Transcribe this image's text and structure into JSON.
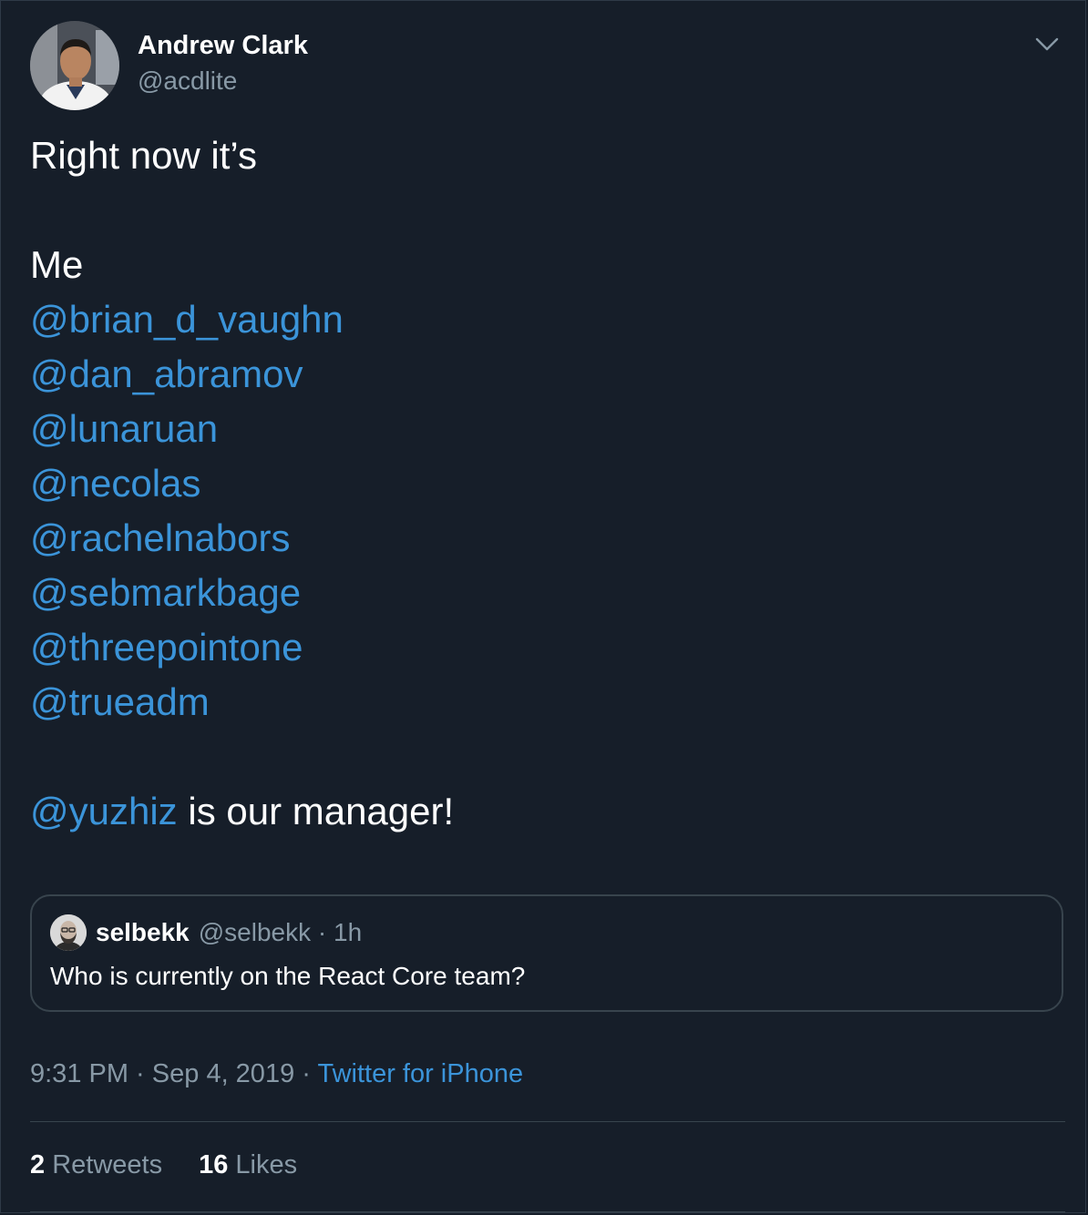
{
  "author": {
    "display_name": "Andrew Clark",
    "handle": "@acdlite"
  },
  "tweet": {
    "intro": "Right now it’s",
    "first_member": "Me",
    "members": [
      "@brian_d_vaughn",
      "@dan_abramov",
      "@lunaruan",
      "@necolas",
      "@rachelnabors",
      "@sebmarkbage",
      "@threepointone",
      "@trueadm"
    ],
    "closing_mention": "@yuzhiz",
    "closing_text": " is our manager!"
  },
  "quote": {
    "name": "selbekk",
    "handle": "@selbekk",
    "separator": " · ",
    "time": "1h",
    "text": "Who is currently on the React Core team?"
  },
  "meta": {
    "time": "9:31 PM",
    "separator": " · ",
    "date": "Sep 4, 2019",
    "source": "Twitter for iPhone"
  },
  "stats": {
    "retweets_count": "2",
    "retweets_label": " Retweets",
    "likes_count": "16",
    "likes_label": " Likes"
  },
  "colors": {
    "background": "#161e29",
    "mention": "#1da1f2",
    "secondary_text": "#8899a6",
    "border": "#38444d"
  }
}
